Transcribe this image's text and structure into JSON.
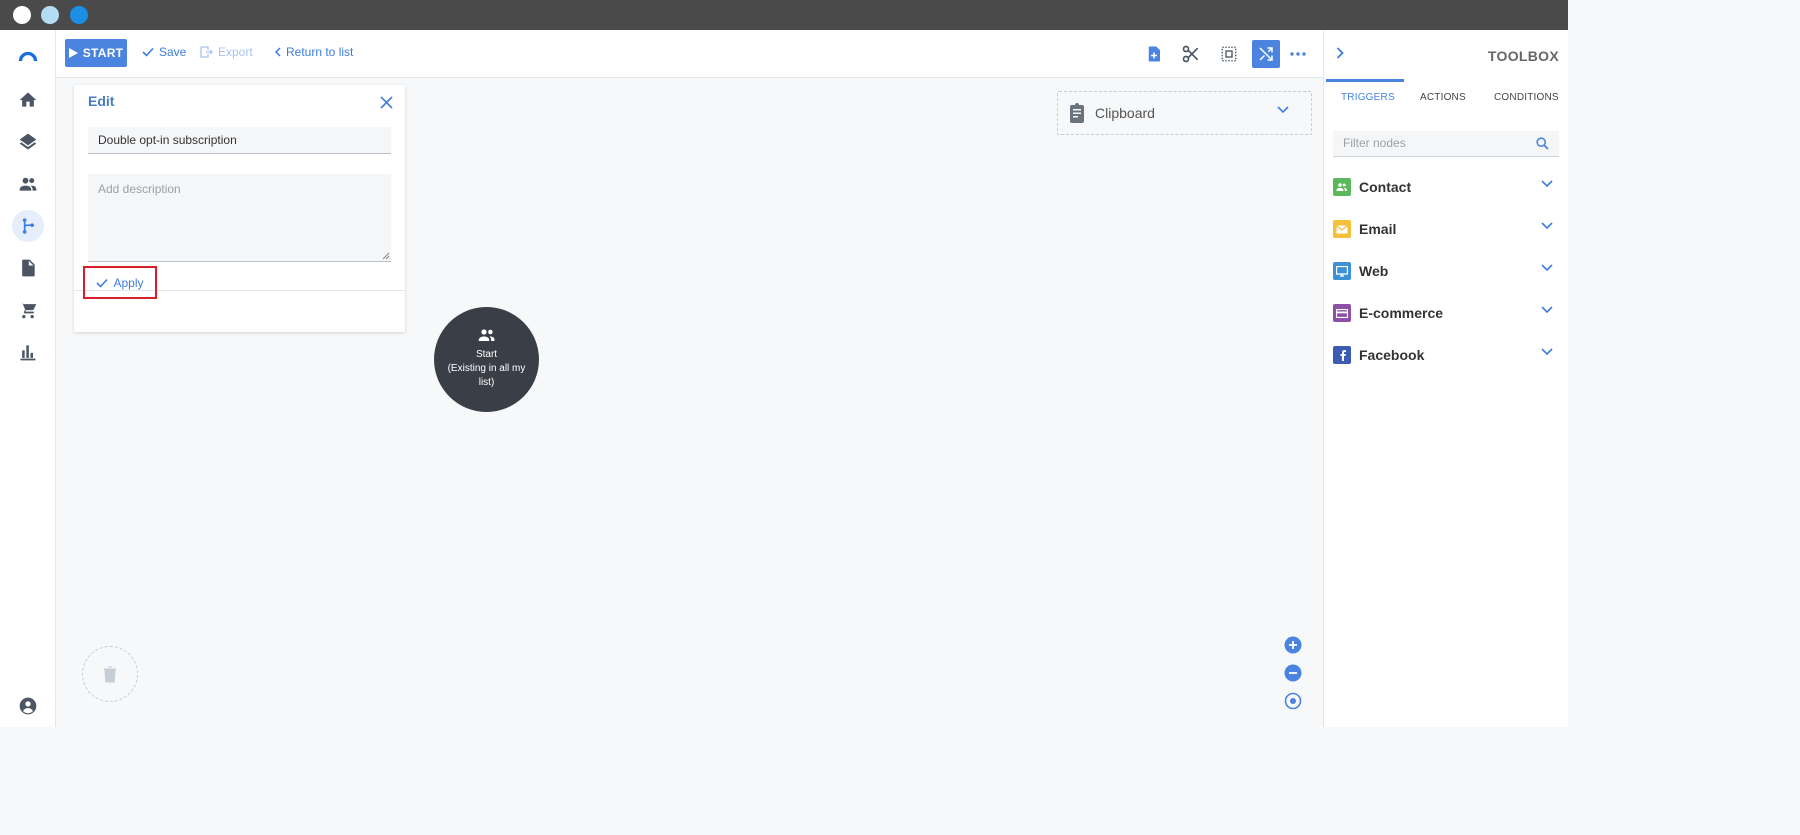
{
  "window": {
    "traffic_lights": [
      {
        "name": "close",
        "color": "#ffffff"
      },
      {
        "name": "minimize",
        "color": "#b3dcf5"
      },
      {
        "name": "maximize",
        "color": "#1a8fe3"
      }
    ]
  },
  "colors": {
    "accent": "#4a84e0",
    "link": "#3d7de0",
    "node_dark": "#3a3f47",
    "highlight_border": "#d9202a"
  },
  "leftnav": {
    "items": [
      {
        "name": "logo",
        "icon": "brand-arc-logo"
      },
      {
        "name": "home",
        "icon": "home-icon"
      },
      {
        "name": "layers",
        "icon": "layers-icon"
      },
      {
        "name": "contacts",
        "icon": "people-icon"
      },
      {
        "name": "automation",
        "icon": "workflow-branch-icon",
        "active": true
      },
      {
        "name": "documents",
        "icon": "document-icon"
      },
      {
        "name": "ecommerce",
        "icon": "cart-icon"
      },
      {
        "name": "reports",
        "icon": "bar-chart-icon"
      },
      {
        "name": "account",
        "icon": "account-circle-icon"
      }
    ]
  },
  "toolbar": {
    "start_label": "START",
    "save_label": "Save",
    "export_label": "Export",
    "return_label": "Return to list",
    "right_icons": [
      "add-note-icon",
      "scissors-icon",
      "select-area-icon",
      "shuffle-icon",
      "more-horiz-icon"
    ]
  },
  "edit_panel": {
    "title": "Edit",
    "name_value": "Double opt-in subscription",
    "description_placeholder": "Add description",
    "apply_label": "Apply"
  },
  "clipboard": {
    "label": "Clipboard"
  },
  "start_node": {
    "title": "Start",
    "subtitle": "(Existing in all my list)"
  },
  "toolbox": {
    "title": "TOOLBOX",
    "tabs": [
      {
        "label": "TRIGGERS",
        "active": true
      },
      {
        "label": "ACTIONS",
        "active": false
      },
      {
        "label": "CONDITIONS",
        "active": false
      }
    ],
    "filter_placeholder": "Filter nodes",
    "categories": [
      {
        "label": "Contact",
        "color": "#5cb85c",
        "icon": "people-icon"
      },
      {
        "label": "Email",
        "color": "#f4c03c",
        "icon": "envelope-icon"
      },
      {
        "label": "Web",
        "color": "#3d8fd6",
        "icon": "monitor-icon"
      },
      {
        "label": "E-commerce",
        "color": "#8e4fa8",
        "icon": "credit-card-icon"
      },
      {
        "label": "Facebook",
        "color": "#3b5bb5",
        "icon": "facebook-icon"
      }
    ]
  }
}
